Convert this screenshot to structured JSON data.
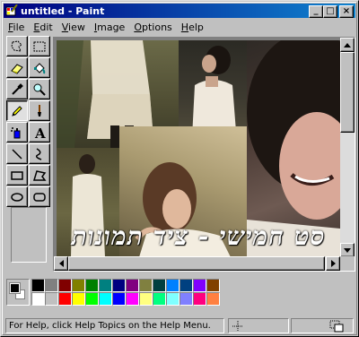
{
  "window": {
    "title": "untitled - Paint",
    "colors": {
      "titlebar_start": "#000080",
      "titlebar_end": "#1084d0",
      "face": "#c0c0c0"
    }
  },
  "title_buttons": [
    {
      "name": "minimize-button",
      "glyph": "_"
    },
    {
      "name": "maximize-button",
      "glyph": "□"
    },
    {
      "name": "close-button",
      "glyph": "×"
    }
  ],
  "menu": [
    {
      "label": "File",
      "key": "F",
      "rest": "ile"
    },
    {
      "label": "Edit",
      "key": "E",
      "rest": "dit"
    },
    {
      "label": "View",
      "key": "V",
      "rest": "iew"
    },
    {
      "label": "Image",
      "key": "I",
      "rest": "mage"
    },
    {
      "label": "Options",
      "key": "O",
      "rest": "ptions"
    },
    {
      "label": "Help",
      "key": "H",
      "rest": "elp"
    }
  ],
  "tools": [
    {
      "icon": "free-form-select-icon",
      "pressed": false
    },
    {
      "icon": "rectangle-select-icon",
      "pressed": false
    },
    {
      "icon": "eraser-icon",
      "pressed": false
    },
    {
      "icon": "fill-bucket-icon",
      "pressed": false
    },
    {
      "icon": "color-picker-icon",
      "pressed": false
    },
    {
      "icon": "magnifier-icon",
      "pressed": false
    },
    {
      "icon": "pencil-icon",
      "pressed": true
    },
    {
      "icon": "brush-icon",
      "pressed": false
    },
    {
      "icon": "airbrush-icon",
      "pressed": false
    },
    {
      "icon": "text-icon",
      "pressed": false
    },
    {
      "icon": "line-icon",
      "pressed": false
    },
    {
      "icon": "curve-icon",
      "pressed": false
    },
    {
      "icon": "rectangle-icon",
      "pressed": false
    },
    {
      "icon": "polygon-icon",
      "pressed": false
    },
    {
      "icon": "ellipse-icon",
      "pressed": false
    },
    {
      "icon": "rounded-rectangle-icon",
      "pressed": false
    }
  ],
  "canvas": {
    "overlay_text": "סט חמישי - ציד תמונות"
  },
  "palette": {
    "foreground": "#000000",
    "background": "#ffffff",
    "colors": [
      "#000000",
      "#808080",
      "#800000",
      "#808000",
      "#008000",
      "#008080",
      "#000080",
      "#800080",
      "#808040",
      "#004040",
      "#0080ff",
      "#004080",
      "#8000ff",
      "#804000",
      "#ffffff",
      "#c0c0c0",
      "#ff0000",
      "#ffff00",
      "#00ff00",
      "#00ffff",
      "#0000ff",
      "#ff00ff",
      "#ffff80",
      "#00ff80",
      "#80ffff",
      "#8080ff",
      "#ff0080",
      "#ff8040"
    ]
  },
  "status": {
    "help_text": "For Help, click Help Topics on the Help Menu."
  }
}
